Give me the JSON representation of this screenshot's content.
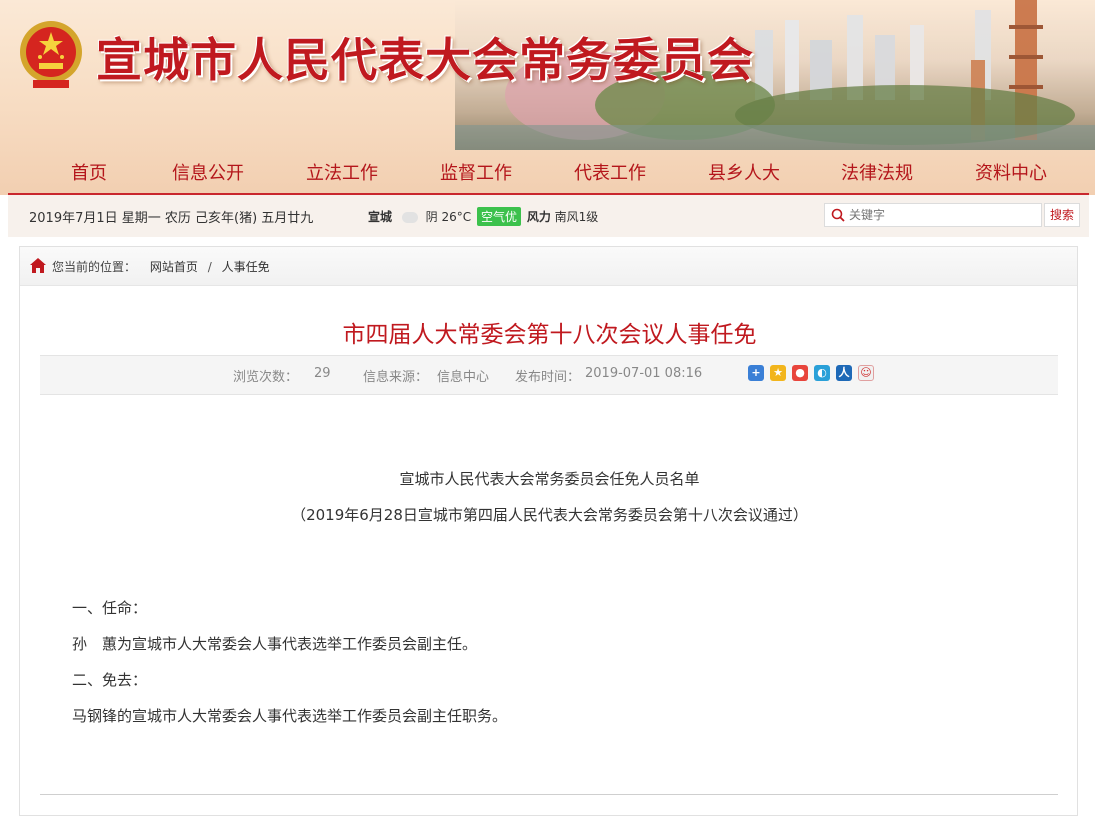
{
  "header": {
    "site_title": "宣城市人民代表大会常务委员会",
    "logo_icon": "national-emblem-icon",
    "title_color": "#c0191f"
  },
  "nav": {
    "items": [
      {
        "label": "首页"
      },
      {
        "label": "信息公开"
      },
      {
        "label": "立法工作"
      },
      {
        "label": "监督工作"
      },
      {
        "label": "代表工作"
      },
      {
        "label": "县乡人大"
      },
      {
        "label": "法律法规"
      },
      {
        "label": "资料中心"
      }
    ]
  },
  "infobar": {
    "date": "2019年7月1日 星期一 农历 己亥年(猪) 五月廿九",
    "weather": {
      "city": "宣城",
      "condition": "阴 26°C",
      "aqi": "空气优",
      "wind_label": "风力",
      "wind_value": "南风1级"
    },
    "search_placeholder": "关键字",
    "search_button": "搜索"
  },
  "breadcrumb": {
    "prefix": "您当前的位置：",
    "items": [
      "网站首页",
      "人事任免"
    ],
    "separator": "/"
  },
  "article": {
    "title": "市四届人大常委会第十八次会议人事任免",
    "meta": {
      "views_label": "浏览次数：",
      "views": "29",
      "source_label": "信息来源：",
      "source": "信息中心",
      "published_label": "发布时间：",
      "published": "2019-07-01 08:16"
    },
    "share_icons": [
      "share-more-icon",
      "qzone-icon",
      "weibo-icon",
      "tencent-weibo-icon",
      "renren-icon",
      "douban-icon"
    ],
    "heading": "宣城市人民代表大会常务委员会任免人员名单",
    "subheading": "（2019年6月28日宣城市第四届人民代表大会常务委员会第十八次会议通过）",
    "paragraphs": [
      "一、任命：",
      "孙　蕙为宣城市人大常委会人事代表选举工作委员会副主任。",
      "二、免去：",
      "马钢锋的宣城市人大常委会人事代表选举工作委员会副主任职务。"
    ]
  }
}
